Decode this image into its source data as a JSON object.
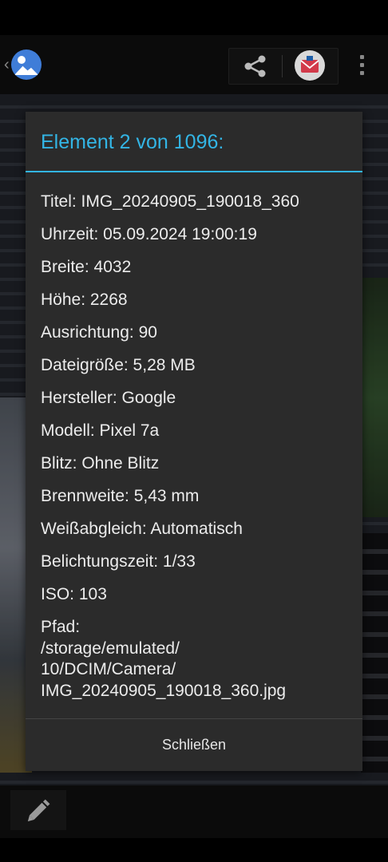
{
  "dialog": {
    "title": "Element 2 von 1096:",
    "rows": [
      "Titel: IMG_20240905_190018_360",
      "Uhrzeit: 05.09.2024 19:00:19",
      "Breite: 4032",
      "Höhe: 2268",
      "Ausrichtung: 90",
      "Dateigröße: 5,28 MB",
      "Hersteller: Google",
      "Modell: Pixel 7a",
      "Blitz: Ohne Blitz",
      "Brennweite: 5,43 mm",
      "Weißabgleich: Automatisch",
      "Belichtungszeit: 1/33",
      "ISO: 103"
    ],
    "path_lines": [
      "Pfad:",
      "/storage/emulated/",
      "10/DCIM/Camera/",
      "IMG_20240905_190018_360.jpg"
    ],
    "close_label": "Schließen",
    "accent_color": "#33b5e5"
  },
  "topbar": {
    "back_glyph": "‹",
    "icons": [
      "gallery-app-icon",
      "share-icon",
      "mail-icon",
      "overflow-menu-icon"
    ]
  },
  "bottom_bar": {
    "icons": [
      "pencil-icon"
    ]
  }
}
